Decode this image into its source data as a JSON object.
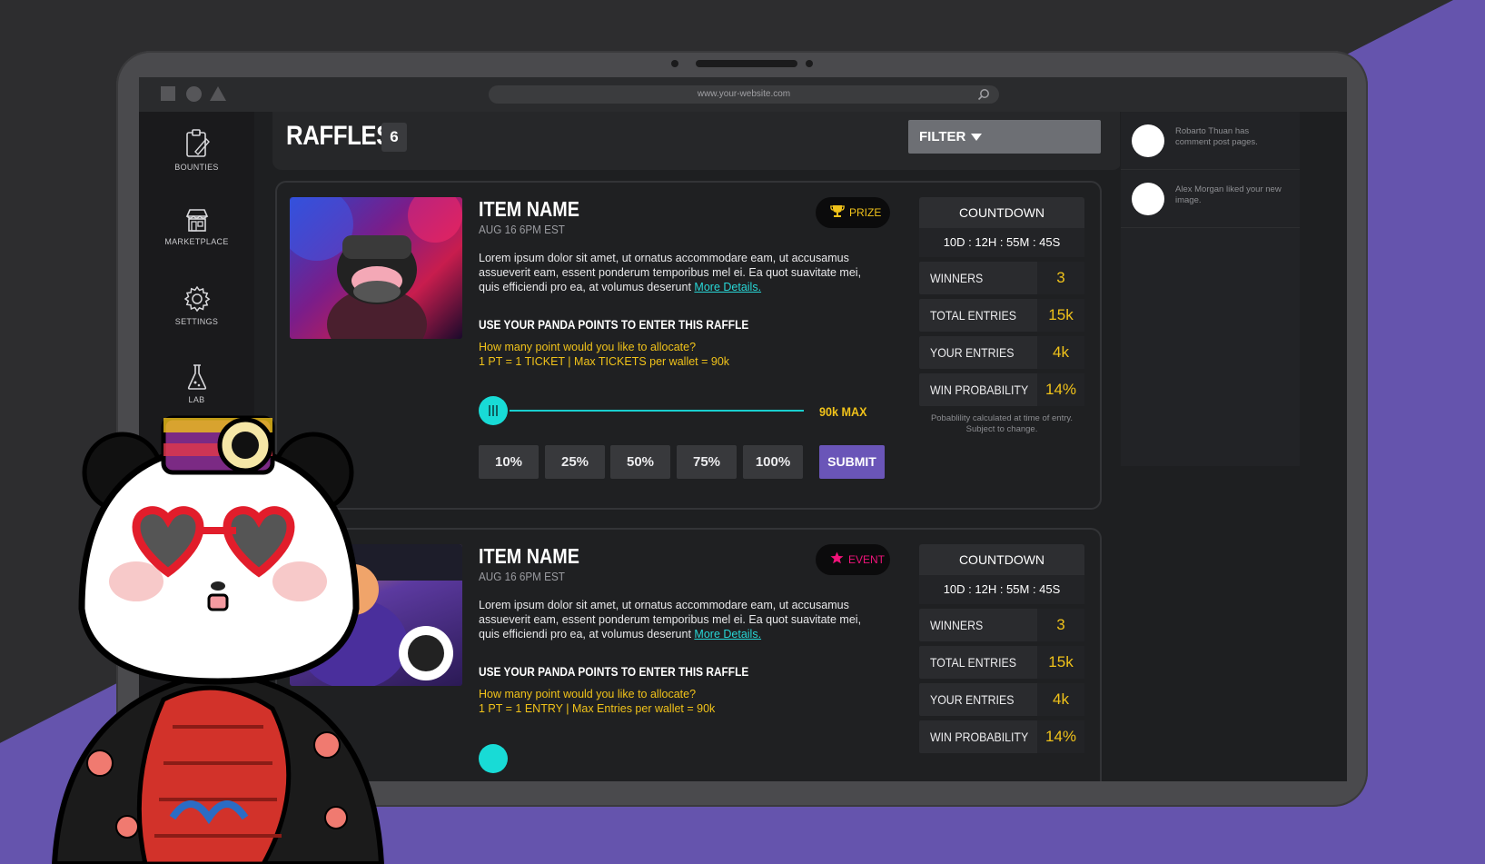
{
  "browser": {
    "url": "www.your-website.com",
    "controls": [
      "square",
      "circle",
      "triangle"
    ]
  },
  "sidebar": {
    "items": [
      {
        "label": "BOUNTIES",
        "icon": "clipboard-icon"
      },
      {
        "label": "MARKETPLACE",
        "icon": "storefront-icon"
      },
      {
        "label": "SETTINGS",
        "icon": "gear-icon"
      },
      {
        "label": "LAB",
        "icon": "flask-icon"
      }
    ]
  },
  "header": {
    "title": "RAFFLES",
    "count": "6",
    "filter_label": "FILTER"
  },
  "raffles": [
    {
      "name": "ITEM NAME",
      "date": "AUG 16 6PM EST",
      "tag": "PRIZE",
      "description": "Lorem ipsum dolor sit amet, ut ornatus accommodare eam, ut accusamus assueverit eam, essent ponderum temporibus mel ei. Ea quot suavitate mei, quis efficiendi pro ea, at volumus deserunt",
      "more_link": "More Details.",
      "enter_title": "USE YOUR PANDA POINTS TO ENTER THIS RAFFLE",
      "question": "How many point would you like to allocate?",
      "rate": "1 PT = 1 TICKET | Max TICKETS per wallet = 90k",
      "max_label": "90k MAX",
      "percent_buttons": [
        "10%",
        "25%",
        "50%",
        "75%",
        "100%"
      ],
      "submit_label": "SUBMIT",
      "countdown_label": "COUNTDOWN",
      "countdown": "10D : 12H : 55M : 45S",
      "stats": [
        {
          "label": "WINNERS",
          "value": "3"
        },
        {
          "label": "TOTAL ENTRIES",
          "value": "15k"
        },
        {
          "label": "YOUR ENTRIES",
          "value": "4k"
        },
        {
          "label": "WIN PROBABILITY",
          "value": "14%"
        }
      ],
      "probability_note": "Pobablility calculated at time of entry. Subject to change."
    },
    {
      "name": "ITEM NAME",
      "date": "AUG 16 6PM EST",
      "tag": "EVENT",
      "description": "Lorem ipsum dolor sit amet, ut ornatus accommodare eam, ut accusamus assueverit eam, essent ponderum temporibus mel ei. Ea quot suavitate mei, quis efficiendi pro ea, at volumus deserunt",
      "more_link": "More Details.",
      "enter_title": "USE YOUR PANDA POINTS TO ENTER THIS RAFFLE",
      "question": "How many point would you like to allocate?",
      "rate": "1 PT = 1 ENTRY | Max Entries per wallet = 90k",
      "countdown_label": "COUNTDOWN",
      "countdown": "10D : 12H : 55M : 45S",
      "stats": [
        {
          "label": "WINNERS",
          "value": "3"
        },
        {
          "label": "TOTAL ENTRIES",
          "value": "15k"
        },
        {
          "label": "YOUR ENTRIES",
          "value": "4k"
        },
        {
          "label": "WIN PROBABILITY",
          "value": "14%"
        }
      ]
    }
  ],
  "notifications": [
    {
      "text": "Robarto Thuan has comment post pages."
    },
    {
      "text": "Alex Morgan liked your new image."
    }
  ],
  "colors": {
    "accent_purple": "#6a55b8",
    "accent_yellow": "#f0c21a",
    "accent_cyan": "#18dbd6",
    "accent_pink": "#f0137a",
    "background": "#2d2d2f"
  }
}
